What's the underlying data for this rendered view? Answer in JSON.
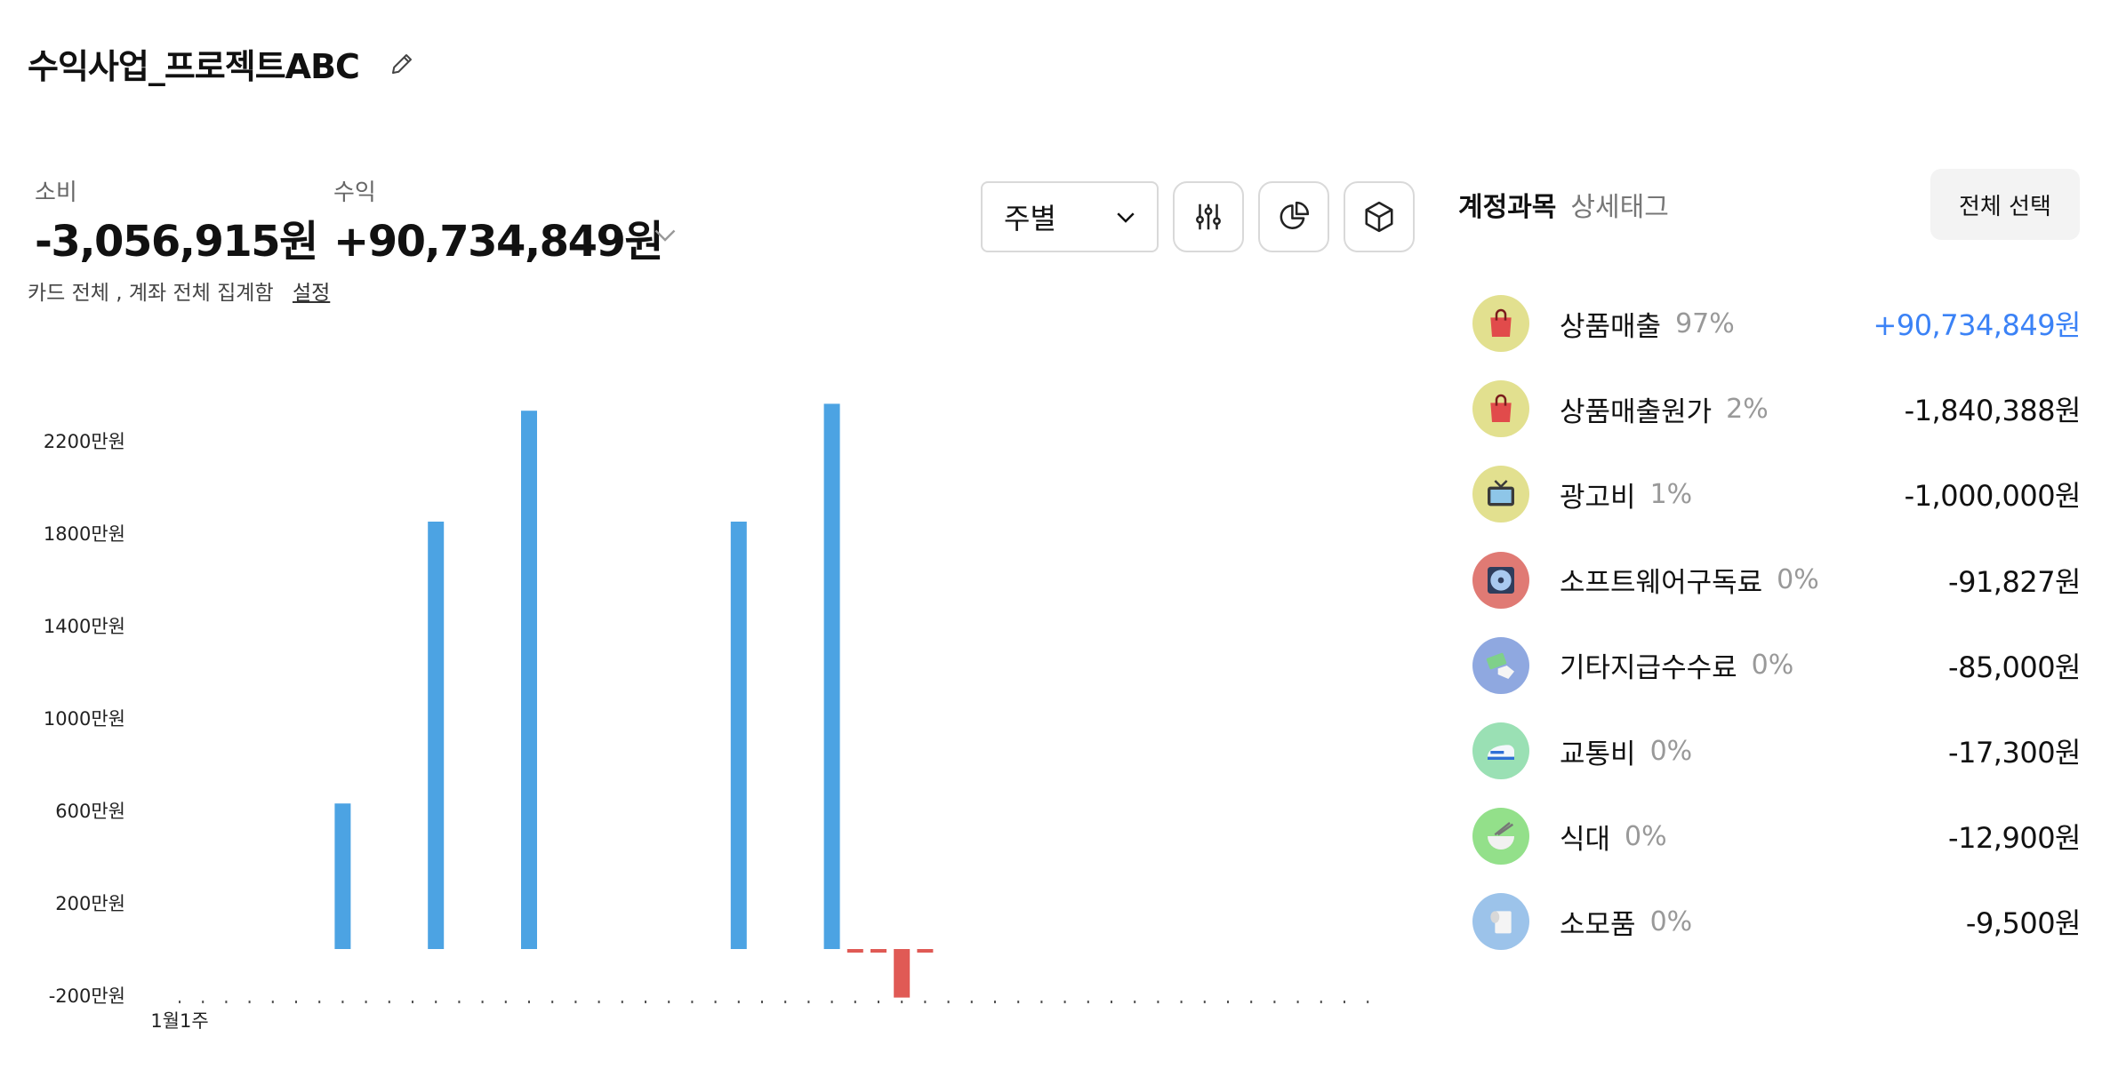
{
  "header": {
    "title": "수익사업_프로젝트ABC"
  },
  "summary": {
    "expense_label": "소비",
    "expense_value": "-3,056,915원",
    "income_label": "수익",
    "income_value": "+90,734,849원",
    "aggregation_text": "카드 전체 , 계좌 전체 집계함",
    "settings_link": "설정"
  },
  "toolbar": {
    "period_value": "주별",
    "filter_icon": "sliders-icon",
    "pie_icon": "pie-chart-icon",
    "box_icon": "cube-icon"
  },
  "chart_data": {
    "type": "bar",
    "unit": "만원",
    "y_ticks": [
      "2200만원",
      "1800만원",
      "1400만원",
      "1000만원",
      "600만원",
      "200만원",
      "-200만원"
    ],
    "y_tick_values": [
      2200,
      1800,
      1400,
      1000,
      600,
      200,
      -200
    ],
    "ylim": [
      -200,
      2400
    ],
    "x_first_label": "1월1주",
    "week_count": 52,
    "income_series": {
      "color": "#4ca3e3",
      "points": [
        {
          "week": 7,
          "value": 630
        },
        {
          "week": 11,
          "value": 1850
        },
        {
          "week": 15,
          "value": 2330
        },
        {
          "week": 24,
          "value": 1850
        },
        {
          "week": 28,
          "value": 2360
        }
      ]
    },
    "expense_series": {
      "color": "#e05a55",
      "points": [
        {
          "week": 29,
          "value": -10
        },
        {
          "week": 30,
          "value": -10
        },
        {
          "week": 31,
          "value": -210
        },
        {
          "week": 32,
          "value": -10
        }
      ]
    }
  },
  "accounts": {
    "tab_active": "계정과목",
    "tab_inactive": "상세태그",
    "select_all": "전체 선택",
    "items": [
      {
        "name": "상품매출",
        "pct": "97%",
        "amount": "+90,734,849원",
        "positive": true,
        "icon": "shopping-bag-icon",
        "bg": "#e2e08f"
      },
      {
        "name": "상품매출원가",
        "pct": "2%",
        "amount": "-1,840,388원",
        "positive": false,
        "icon": "shopping-bag-icon",
        "bg": "#e2e08f"
      },
      {
        "name": "광고비",
        "pct": "1%",
        "amount": "-1,000,000원",
        "positive": false,
        "icon": "tv-icon",
        "bg": "#e2e08f"
      },
      {
        "name": "소프트웨어구독료",
        "pct": "0%",
        "amount": "-91,827원",
        "positive": false,
        "icon": "disc-icon",
        "bg": "#e07a74"
      },
      {
        "name": "기타지급수수료",
        "pct": "0%",
        "amount": "-85,000원",
        "positive": false,
        "icon": "money-hand-icon",
        "bg": "#8fa8e0"
      },
      {
        "name": "교통비",
        "pct": "0%",
        "amount": "-17,300원",
        "positive": false,
        "icon": "train-icon",
        "bg": "#9ae0b4"
      },
      {
        "name": "식대",
        "pct": "0%",
        "amount": "-12,900원",
        "positive": false,
        "icon": "bowl-icon",
        "bg": "#93e08a"
      },
      {
        "name": "소모품",
        "pct": "0%",
        "amount": "-9,500원",
        "positive": false,
        "icon": "tissue-icon",
        "bg": "#9cc3ea"
      }
    ]
  }
}
